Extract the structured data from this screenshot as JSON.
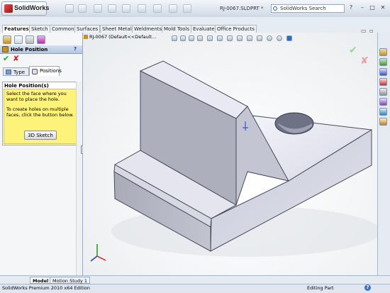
{
  "app": {
    "name": "SolidWorks",
    "document_title": "RJ-0067.SLDPRT *"
  },
  "search": {
    "placeholder": "SolidWorks Search"
  },
  "window": {
    "minimize": "–",
    "maximize": "□",
    "close": "✕",
    "help": "?"
  },
  "tabs": [
    "Features",
    "Sketch",
    "Common",
    "Surfaces",
    "Sheet Metal",
    "Weldments",
    "Mold Tools",
    "Evaluate",
    "Office Products"
  ],
  "active_tab": "Features",
  "property_manager": {
    "title": "Hole Position",
    "help": "?",
    "ok": "✔",
    "cancel": "✘",
    "sub_tabs": [
      "Type",
      "Positions"
    ],
    "active_sub_tab": "Positions",
    "group_title": "Hole Position(s)",
    "message_1": "Select the face where you want to place the hole.",
    "message_2": "To create holes on multiple faces, click the button below.",
    "button": "3D Sketch"
  },
  "viewport": {
    "tree_label": "RJ-0067  (Default<<Default...",
    "ok": "✔",
    "cancel": "✘"
  },
  "bottom_tabs": [
    "Model",
    "Motion Study 1"
  ],
  "active_bottom_tab": "Model",
  "status": {
    "left": "SolidWorks Premium 2010 x64 Edition",
    "mode": "Editing Part",
    "help": "?"
  },
  "colors": {
    "accent": "#b5c7e2",
    "part_top": "#e6e7f0",
    "part_side": "#b8bac8",
    "ok": "#23a523",
    "cancel": "#d02020",
    "message_bg": "#fdf27a"
  }
}
